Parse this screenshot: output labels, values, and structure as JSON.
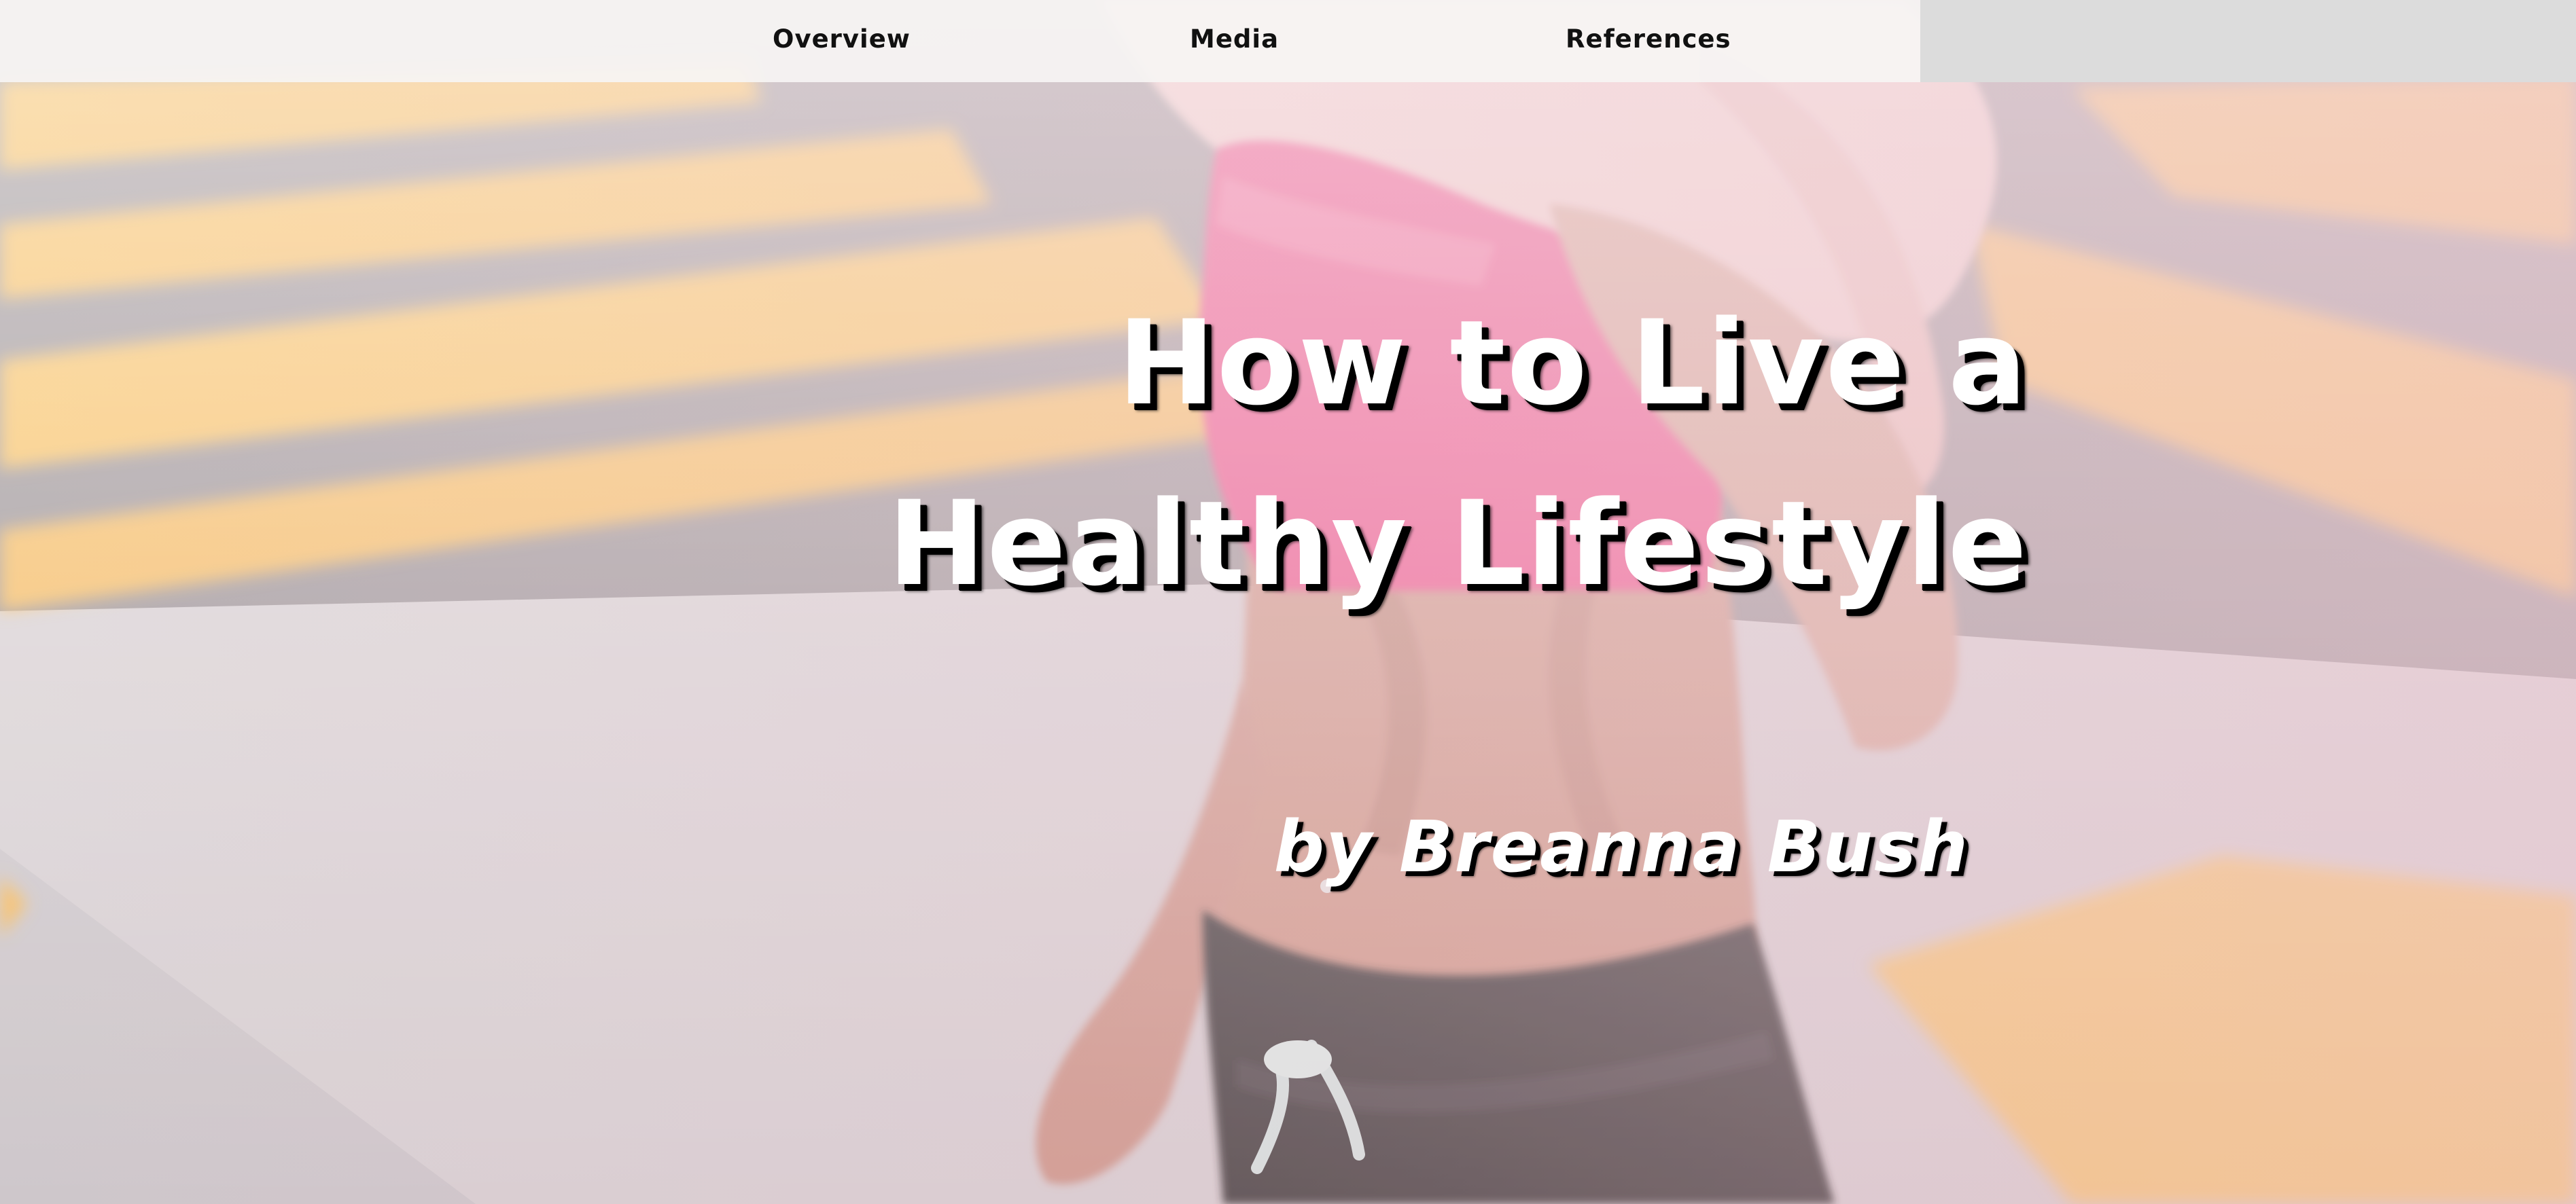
{
  "nav": {
    "items": [
      {
        "label": "Overview"
      },
      {
        "label": "Media"
      },
      {
        "label": "References"
      }
    ]
  },
  "hero": {
    "title_line_1": "How to Live a",
    "title_line_2": "Healthy Lifestyle",
    "byline": "by Breanna Bush",
    "background_subject": "woman running on a crosswalk in a pink sports bra",
    "colors": {
      "stripe": "#f6b54a",
      "asphalt": "#8f8589",
      "bra": "#ec3c7c",
      "skin": "#c98c7a",
      "shorts": "#2a2628",
      "hair": "#f0c8c4",
      "title_text": "#ffffff",
      "title_shadow": "#000000"
    }
  }
}
